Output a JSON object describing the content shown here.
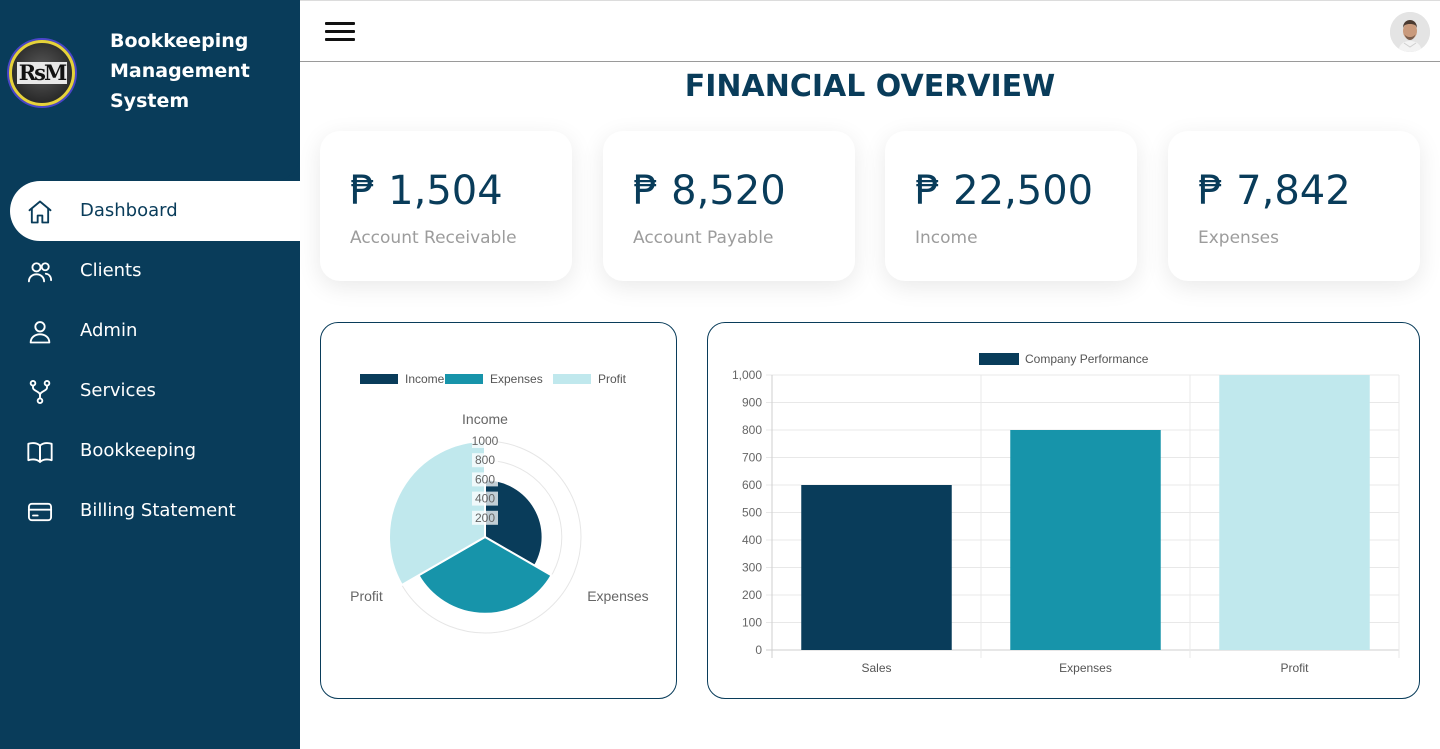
{
  "brand": {
    "logo_text": "RsM",
    "name_line1": "Bookkeeping",
    "name_line2": "Management",
    "name_line3": "System"
  },
  "sidebar": {
    "items": [
      {
        "label": "Dashboard",
        "icon": "home-icon",
        "active": true
      },
      {
        "label": "Clients",
        "icon": "users-icon"
      },
      {
        "label": "Admin",
        "icon": "user-icon"
      },
      {
        "label": "Services",
        "icon": "git-fork-icon"
      },
      {
        "label": "Bookkeeping",
        "icon": "book-open-icon"
      },
      {
        "label": "Billing Statement",
        "icon": "credit-card-icon"
      }
    ]
  },
  "topbar": {
    "menu_icon": "hamburger-icon",
    "avatar_icon": "user-avatar"
  },
  "page": {
    "title": "FINANCIAL OVERVIEW"
  },
  "cards": [
    {
      "value": "₱ 1,504",
      "label": "Account Receivable"
    },
    {
      "value": "₱ 8,520",
      "label": "Account Payable"
    },
    {
      "value": "₱ 22,500",
      "label": "Income"
    },
    {
      "value": "₱ 7,842",
      "label": "Expenses"
    }
  ],
  "colors": {
    "primary": "#093c5a",
    "income": "#093c5a",
    "expenses": "#1794aa",
    "profit": "#c0e8ed"
  },
  "chart_data": [
    {
      "type": "polarArea",
      "legend": [
        "Income",
        "Expenses",
        "Profit"
      ],
      "categories": [
        "Income",
        "Expenses",
        "Profit"
      ],
      "values": [
        600,
        800,
        1000
      ],
      "r_ticks": [
        200,
        400,
        600,
        800,
        1000
      ],
      "rlim": [
        0,
        1000
      ],
      "legend_position": "top"
    },
    {
      "type": "bar",
      "legend": [
        "Company Performance"
      ],
      "categories": [
        "Sales",
        "Expenses",
        "Profit"
      ],
      "series": [
        {
          "name": "Company Performance",
          "values": [
            600,
            800,
            1000
          ]
        }
      ],
      "y_ticks": [
        "0",
        "100",
        "200",
        "300",
        "400",
        "500",
        "600",
        "700",
        "800",
        "900",
        "1,000"
      ],
      "ylim": [
        0,
        1000
      ],
      "grid": true,
      "legend_position": "top"
    }
  ]
}
